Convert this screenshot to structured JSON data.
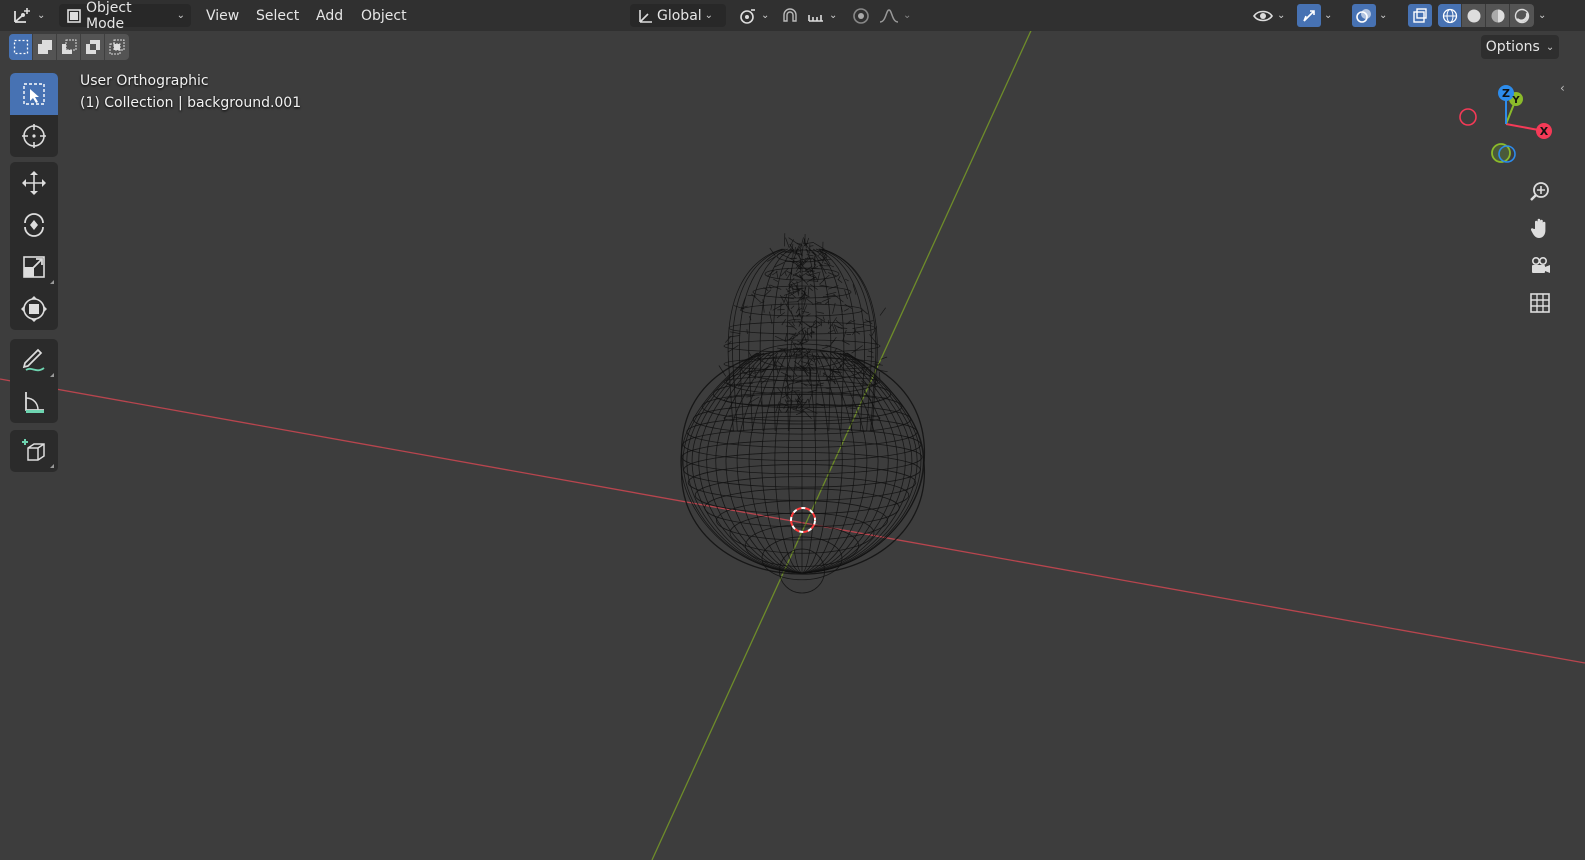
{
  "header": {
    "mode_label": "Object Mode",
    "menus": [
      "View",
      "Select",
      "Add",
      "Object"
    ],
    "transform_orientation": "Global"
  },
  "viewport": {
    "view_name": "User Orthographic",
    "collection_label": "(1) Collection | background.001"
  },
  "options_label": "Options",
  "gizmo": {
    "axis_x": "X",
    "axis_y": "Y",
    "axis_z": "Z",
    "colors": {
      "x": "#f53a57",
      "y": "#8bbb2a",
      "z": "#2d8ceb"
    }
  },
  "colors": {
    "accent": "#4772b3",
    "x_axis_line": "#b8454e",
    "y_axis_line": "#6e8c2a",
    "wireframe": "#111111",
    "cursor_red": "#ff3b3b"
  },
  "icons": {
    "editor_type": "viewport-editor-icon",
    "tools": [
      "select-box-icon",
      "cursor-icon",
      "move-icon",
      "rotate-icon",
      "scale-icon",
      "transform-icon",
      "annotate-icon",
      "measure-icon",
      "add-cube-icon"
    ],
    "navigation": [
      "zoom-icon",
      "pan-hand-icon",
      "camera-icon",
      "grid-icon"
    ]
  }
}
